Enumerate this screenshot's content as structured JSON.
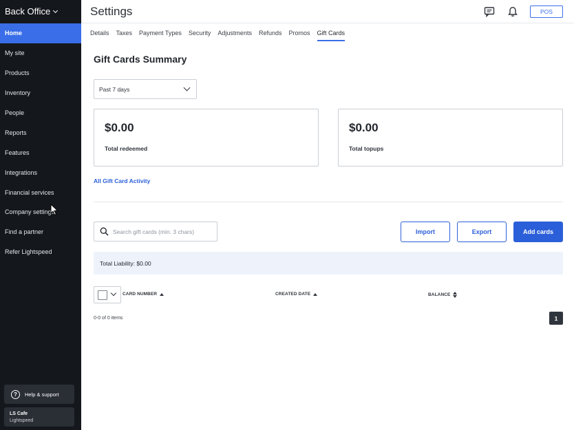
{
  "sidebar": {
    "brand": "Back Office",
    "items": [
      {
        "label": "Home",
        "active": true
      },
      {
        "label": "My site"
      },
      {
        "label": "Products"
      },
      {
        "label": "Inventory"
      },
      {
        "label": "People"
      },
      {
        "label": "Reports"
      },
      {
        "label": "Features"
      },
      {
        "label": "Integrations"
      },
      {
        "label": "Financial services"
      },
      {
        "label": "Company settings"
      },
      {
        "label": "Find a partner"
      },
      {
        "label": "Refer Lightspeed"
      }
    ],
    "help_label": "Help & support",
    "account": {
      "business": "LS Cafe",
      "company": "Lightspeed"
    }
  },
  "header": {
    "title": "Settings",
    "icons": [
      "chat-icon",
      "bell-icon"
    ],
    "pos_label": "POS"
  },
  "tabs": [
    {
      "label": "Details"
    },
    {
      "label": "Taxes"
    },
    {
      "label": "Payment Types"
    },
    {
      "label": "Security"
    },
    {
      "label": "Adjustments"
    },
    {
      "label": "Refunds"
    },
    {
      "label": "Promos"
    },
    {
      "label": "Gift Cards",
      "active": true
    }
  ],
  "main": {
    "section_title": "Gift Cards Summary",
    "period": "Past 7 days",
    "cards": [
      {
        "amount": "$0.00",
        "label": "Total redeemed"
      },
      {
        "amount": "$0.00",
        "label": "Total topups"
      }
    ],
    "activity_link": "All Gift Card Activity",
    "search_placeholder": "Search gift cards (min. 3 chars)",
    "buttons": {
      "import": "Import",
      "export": "Export",
      "add": "Add cards"
    },
    "liability": "Total Liability: $0.00",
    "columns": {
      "card_number": "CARD NUMBER",
      "created_date": "CREATED DATE",
      "balance": "BALANCE"
    },
    "count": "0-0 of 0 items",
    "page": "1"
  },
  "colors": {
    "accent": "#3a6ee8",
    "link": "#2b5fd9",
    "sidebar_bg": "#14171c",
    "liability_bg": "#eef3fb"
  }
}
